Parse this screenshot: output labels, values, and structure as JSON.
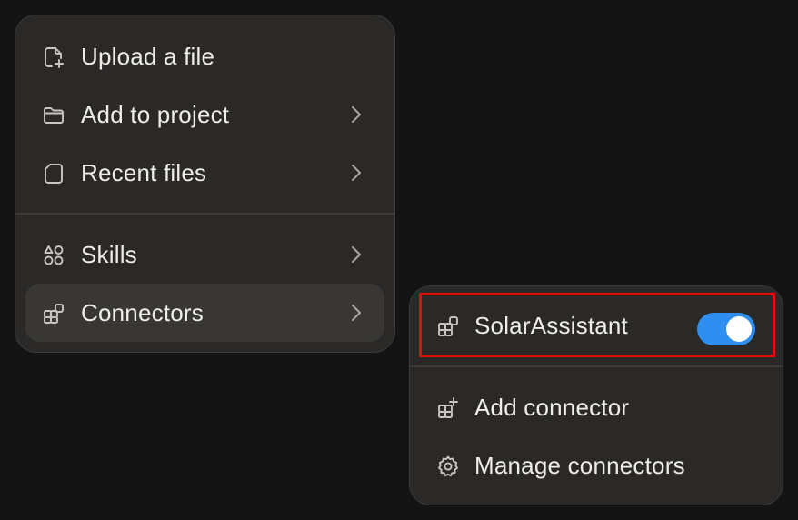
{
  "main_menu": {
    "items": [
      {
        "label": "Upload a file",
        "icon": "upload-file-icon",
        "has_submenu": false
      },
      {
        "label": "Add to project",
        "icon": "folder-icon",
        "has_submenu": true
      },
      {
        "label": "Recent files",
        "icon": "file-icon",
        "has_submenu": true
      },
      {
        "label": "Skills",
        "icon": "skills-icon",
        "has_submenu": true
      },
      {
        "label": "Connectors",
        "icon": "connectors-icon",
        "has_submenu": true,
        "active": true
      }
    ]
  },
  "connectors_menu": {
    "connector": {
      "label": "SolarAssistant",
      "icon": "connector-icon",
      "enabled": true
    },
    "items": [
      {
        "label": "Add connector",
        "icon": "add-connector-icon"
      },
      {
        "label": "Manage connectors",
        "icon": "gear-icon"
      }
    ]
  },
  "colors": {
    "background": "#151414",
    "menu_background": "#2a2928",
    "active_item": "#383735",
    "toggle_on": "#2f8ff0",
    "highlight_box": "#e10d0d",
    "text": "#efede8"
  }
}
